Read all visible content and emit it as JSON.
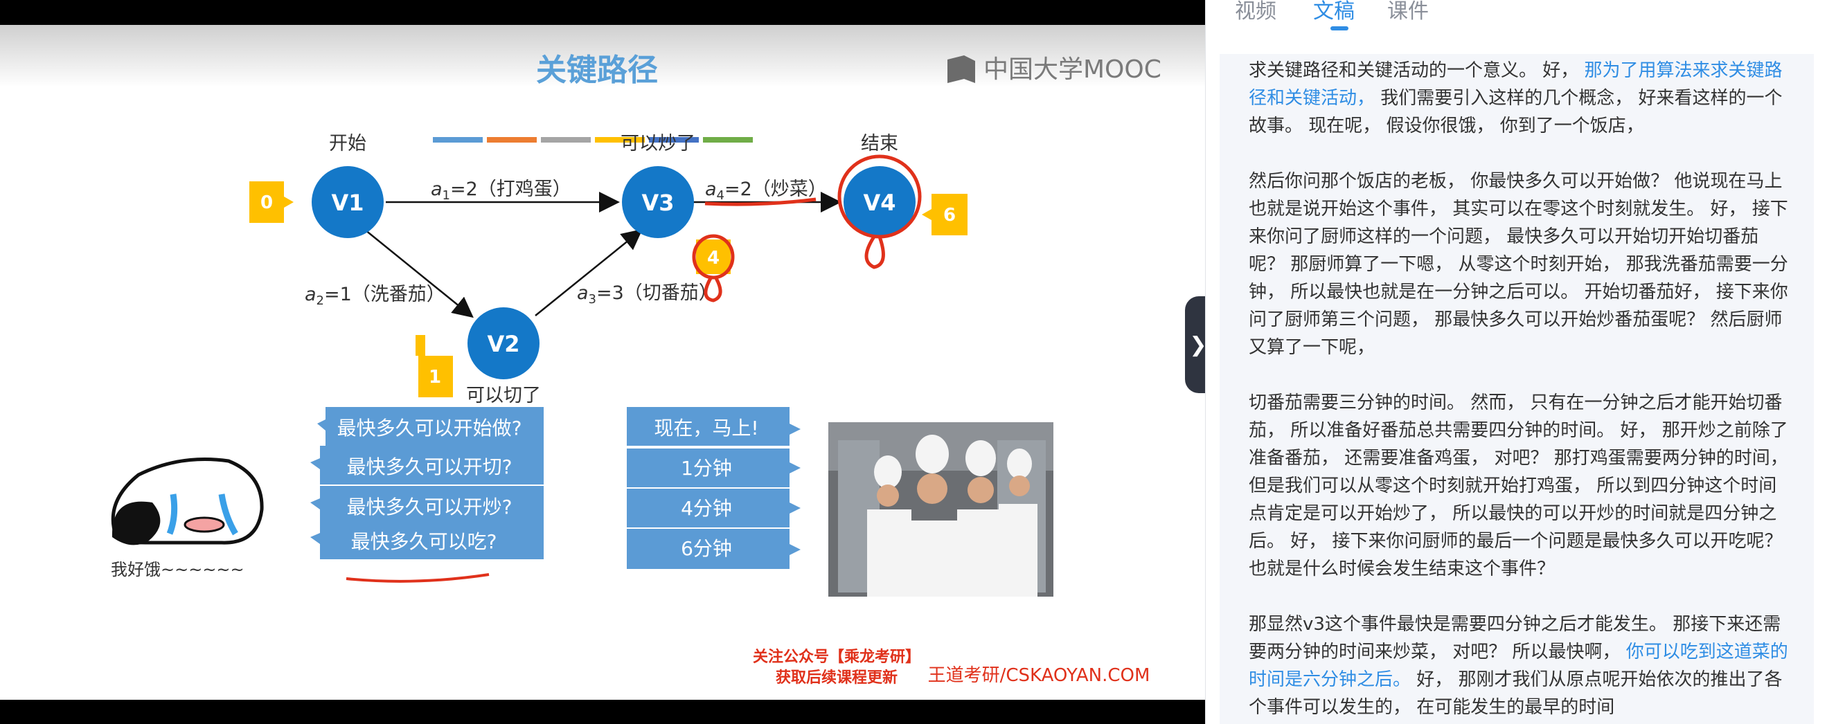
{
  "slide": {
    "title": "关键路径",
    "brand": "中国大学MOOC",
    "color_bars": [
      "#5b9bd5",
      "#ed7d31",
      "#a5a5a5",
      "#ffc000",
      "#4472c4",
      "#70ad47"
    ],
    "nodes": [
      {
        "id": "V1",
        "caption": "开始",
        "time": "0"
      },
      {
        "id": "V2",
        "caption": "可以切了",
        "time": "1"
      },
      {
        "id": "V3",
        "caption": "可以炒了",
        "time": "4"
      },
      {
        "id": "V4",
        "caption": "结束",
        "time": "6"
      }
    ],
    "edges": [
      {
        "name": "a",
        "sub": "1",
        "rest": "=2（打鸡蛋）"
      },
      {
        "name": "a",
        "sub": "2",
        "rest": "=1（洗番茄）"
      },
      {
        "name": "a",
        "sub": "3",
        "rest": "=3（切番茄）"
      },
      {
        "name": "a",
        "sub": "4",
        "rest": "=2（炒菜）"
      }
    ],
    "questions": [
      "最快多久可以开始做?",
      "最快多久可以开切?",
      "最快多久可以开炒?",
      "最快多久可以吃?"
    ],
    "answers": [
      "现在，马上!",
      "1分钟",
      "4分钟",
      "6分钟"
    ],
    "hungry_text": "我好饿~~~~~~",
    "promo_line1": "关注公众号【乘龙考研】",
    "promo_line2": "获取后续课程更新",
    "wangdao": "王道考研/CSKAOYAN.COM"
  },
  "panel": {
    "tabs": [
      {
        "label": "视频",
        "active": false
      },
      {
        "label": "文稿",
        "active": true
      },
      {
        "label": "课件",
        "active": false
      }
    ],
    "collapse_icon": "chevron-right-icon",
    "paragraphs": [
      {
        "parts": [
          {
            "t": "求关键路径和关键活动的一个意义。 好， ",
            "hl": false
          },
          {
            "t": "那为了用算法来求关键路径和关键活动，",
            "hl": true
          },
          {
            "t": " 我们需要引入这样的几个概念， 好来看这样的一个故事。 现在呢， 假设你很饿， 你到了一个饭店，",
            "hl": false
          }
        ]
      },
      {
        "parts": [
          {
            "t": "然后你问那个饭店的老板， 你最快多久可以开始做？ 他说现在马上也就是说开始这个事件， 其实可以在零这个时刻就发生。 好， 接下来你问了厨师这样的一个问题， 最快多久可以开始切开始切番茄呢？ 那厨师算了一下嗯， 从零这个时刻开始， 那我洗番茄需要一分钟， 所以最快也就是在一分钟之后可以。 开始切番茄好， 接下来你问了厨师第三个问题， 那最快多久可以开始炒番茄蛋呢？ 然后厨师又算了一下呢，",
            "hl": false
          }
        ]
      },
      {
        "parts": [
          {
            "t": "切番茄需要三分钟的时间。 然而， 只有在一分钟之后才能开始切番茄， 所以准备好番茄总共需要四分钟的时间。 好， 那开炒之前除了准备番茄， 还需要准备鸡蛋， 对吧？ 那打鸡蛋需要两分钟的时间， 但是我们可以从零这个时刻就开始打鸡蛋， 所以到四分钟这个时间点肯定是可以开始炒了， 所以最快的可以开炒的时间就是四分钟之后。 好， 接下来你问厨师的最后一个问题是最快多久可以开吃呢？ 也就是什么时候会发生结束这个事件？",
            "hl": false
          }
        ]
      },
      {
        "parts": [
          {
            "t": "那显然v3这个事件最快是需要四分钟之后才能发生。 那接下来还需要两分钟的时间来炒菜， 对吧？ 所以最快啊， ",
            "hl": false
          },
          {
            "t": "你可以吃到这道菜的时间是六分钟之后。",
            "hl": true
          },
          {
            "t": " 好， 那刚才我们从原点呢开始依次的推出了各个事件可以发生的， 在可能发生的最早的时间",
            "hl": false
          }
        ]
      }
    ]
  }
}
